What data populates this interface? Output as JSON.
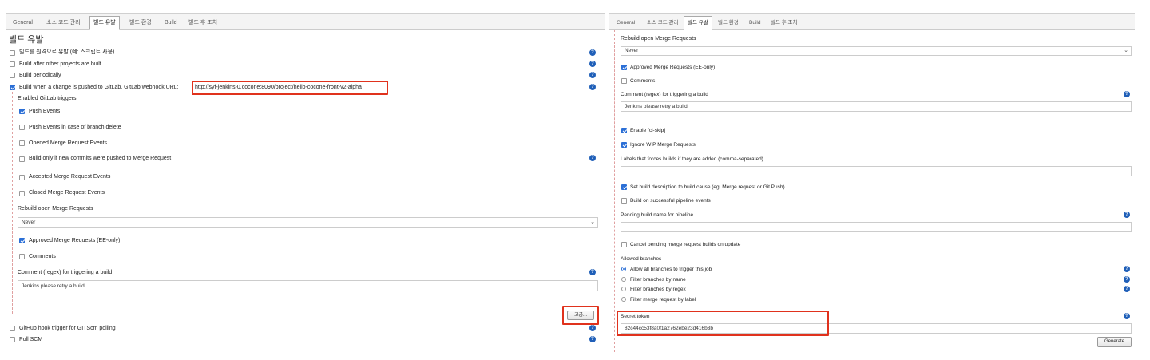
{
  "left": {
    "tabs": [
      "General",
      "소스 코드 관리",
      "빌드 유발",
      "빌드 환경",
      "Build",
      "빌드 후 조치"
    ],
    "section_title": "빌드 유발",
    "triggers": {
      "remote": "빌드를 원격으로 유발 (예: 스크립트 사용)",
      "after_other": "Build after other projects are built",
      "periodically": "Build periodically",
      "gitlab": "Build when a change is pushed to GitLab. GitLab webhook URL:",
      "webhook_url": "http://syf-jenkins-0.cocone:8090/project/hello-cocone-front-v2-alpha",
      "enabled_triggers": "Enabled GitLab triggers",
      "push_events": "Push Events",
      "push_branch_delete": "Push Events in case of branch delete",
      "opened_mr": "Opened Merge Request Events",
      "only_new_commits": "Build only if new commits were pushed to Merge Request",
      "accepted_mr": "Accepted Merge Request Events",
      "closed_mr": "Closed Merge Request Events",
      "rebuild_label": "Rebuild open Merge Requests",
      "rebuild_value": "Never",
      "approved_mr": "Approved Merge Requests (EE-only)",
      "comments": "Comments",
      "comment_regex_label": "Comment (regex) for triggering a build",
      "comment_regex_value": "Jenkins please retry a build",
      "advanced_button": "고급...",
      "github_hook": "GitHub hook trigger for GITScm polling",
      "poll_scm": "Poll SCM"
    }
  },
  "right": {
    "tabs": [
      "General",
      "소스 코드 관리",
      "빌드 유발",
      "빌드 환경",
      "Build",
      "빌드 후 조치"
    ],
    "rebuild_label": "Rebuild open Merge Requests",
    "rebuild_value": "Never",
    "approved_mr": "Approved Merge Requests (EE-only)",
    "comments": "Comments",
    "comment_regex_label": "Comment (regex) for triggering a build",
    "comment_regex_value": "Jenkins please retry a build",
    "enable_ci_skip": "Enable [ci-skip]",
    "ignore_wip": "Ignore WIP Merge Requests",
    "labels_force_label": "Labels that forces builds if they are added (comma-separated)",
    "labels_force_value": "",
    "set_description": "Set build description to build cause (eg. Merge request or Git Push)",
    "build_pipeline_events": "Build on successful pipeline events",
    "pending_build_label": "Pending build name for pipeline",
    "pending_build_value": "",
    "cancel_pending": "Cancel pending merge request builds on update",
    "allowed_branches_label": "Allowed branches",
    "branch_options": [
      "Allow all branches to trigger this job",
      "Filter branches by name",
      "Filter branches by regex",
      "Filter merge request by label"
    ],
    "secret_token_label": "Secret token",
    "secret_token_value": "82c44cc53f8a0f1a2762ebe23d416b3b",
    "generate_button": "Generate"
  },
  "colors": {
    "accent": "#2b6fd6",
    "highlight": "#e0321d",
    "help": "#1f5fb8"
  },
  "icons": [
    "help-icon",
    "checkbox",
    "radio",
    "chevron-down-icon"
  ]
}
